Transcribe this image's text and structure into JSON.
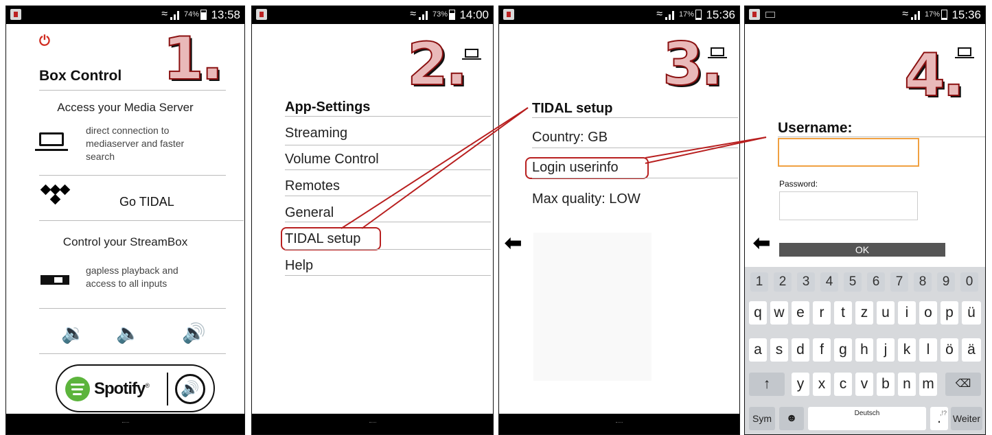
{
  "colors": {
    "accent_red": "#b81f1f",
    "power_red": "#d02a1e",
    "spotify_green": "#5cb43c",
    "input_orange": "#f0a040"
  },
  "panels": [
    {
      "status": {
        "battery_pct": "74%",
        "time": "13:58"
      },
      "step_number": "1.",
      "power_icon": "power-icon",
      "title": "Box Control",
      "media_server_heading": "Access your Media Server",
      "media_server_desc": [
        "direct connection to",
        "mediaserver and faster",
        "search"
      ],
      "tidal_label": "Go TIDAL",
      "streambox_heading": "Control your StreamBox",
      "streambox_desc": [
        "gapless playback and",
        "access to all inputs"
      ],
      "volume_icons": [
        "volume-down-icon",
        "mute-icon",
        "volume-up-icon"
      ],
      "spotify_label": "Spotify",
      "spotify_reg": "®"
    },
    {
      "status": {
        "battery_pct": "73%",
        "time": "14:00"
      },
      "step_number": "2.",
      "header": "App-Settings",
      "items": [
        "Streaming",
        "Volume Control",
        "Remotes",
        "General",
        "TIDAL setup",
        "Help"
      ]
    },
    {
      "status": {
        "battery_pct": "17%",
        "time": "15:36"
      },
      "step_number": "3.",
      "header": "TIDAL setup",
      "items": [
        "Country: GB",
        "Login userinfo",
        "Max quality: LOW"
      ]
    },
    {
      "status": {
        "battery_pct": "17%",
        "time": "15:36"
      },
      "step_number": "4.",
      "username_label": "Username:",
      "password_label": "Password:",
      "ok_label": "OK",
      "keyboard": {
        "numbers": [
          "1",
          "2",
          "3",
          "4",
          "5",
          "6",
          "7",
          "8",
          "9",
          "0"
        ],
        "row1": [
          "q",
          "w",
          "e",
          "r",
          "t",
          "z",
          "u",
          "i",
          "o",
          "p",
          "ü"
        ],
        "row2": [
          "a",
          "s",
          "d",
          "f",
          "g",
          "h",
          "j",
          "k",
          "l",
          "ö",
          "ä"
        ],
        "row3": [
          "y",
          "x",
          "c",
          "v",
          "b",
          "n",
          "m"
        ],
        "sym": "Sym",
        "space": "Deutsch",
        "period": ".",
        "period_hint": ",!?",
        "next": "Weiter"
      }
    }
  ]
}
